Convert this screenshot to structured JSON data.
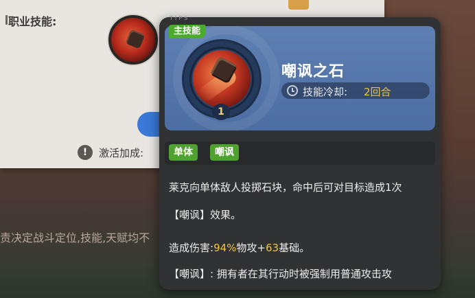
{
  "background": {
    "section_heading": "职业技能:",
    "bonus_icon": "!",
    "bonus_label": "激活加成:",
    "bottom_text": "责决定战斗定位,技能,天赋均不"
  },
  "tooltip": {
    "tips_label": "TIPS",
    "main_badge": "主技能",
    "skill_icon": "rock-throw-icon",
    "level": "1",
    "skill_name": "嘲讽之石",
    "cooldown": {
      "icon": "clock-icon",
      "label": "技能冷却:",
      "value": "2回合"
    },
    "tags": [
      "单体",
      "嘲讽"
    ],
    "description": {
      "line1": "莱克向单体敌人投掷石块，命中后可对目标造成1次",
      "line2": "【嘲讽】效果。",
      "damage_prefix": "造成伤害:",
      "damage_pct": "94%",
      "damage_mid": "物攻+",
      "damage_base": "63",
      "damage_suffix": "基础。",
      "note": "【嘲讽】: 拥有者在其行动时被强制用普通攻击攻"
    }
  },
  "colors": {
    "header_blue": "#5e7fb2",
    "tag_green": "#4fa230",
    "highlight_yellow": "#f2c43c",
    "tooltip_bg": "#313234"
  }
}
